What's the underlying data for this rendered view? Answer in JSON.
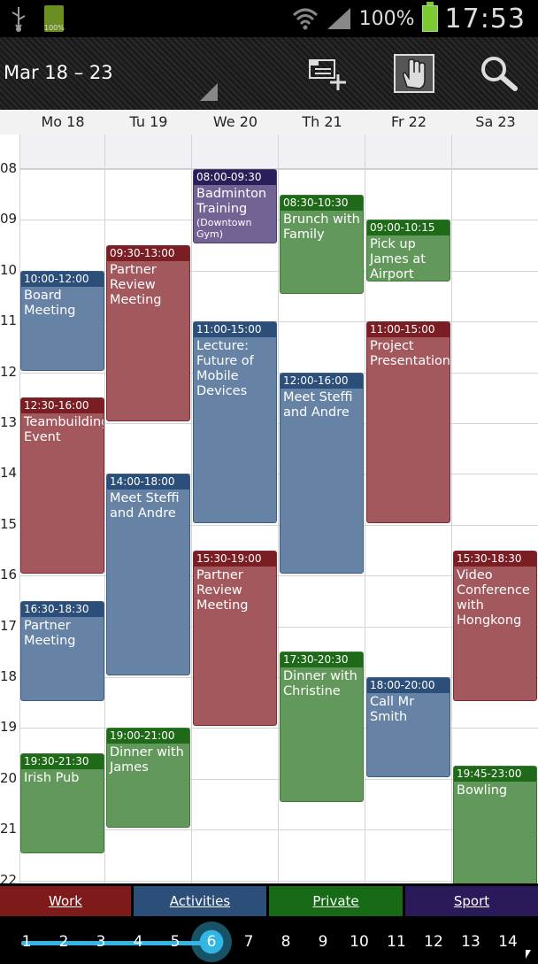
{
  "status": {
    "battery_small_label": "100%",
    "battery_pct": "100%",
    "time": "17:53"
  },
  "header": {
    "date_range": "Mar 18 – 23"
  },
  "days": [
    "Mo 18",
    "Tu 19",
    "We 20",
    "Th 21",
    "Fr 22",
    "Sa 23"
  ],
  "hours": [
    "08",
    "09",
    "10",
    "11",
    "12",
    "13",
    "14",
    "15",
    "16",
    "17",
    "18",
    "19",
    "20",
    "21",
    "22"
  ],
  "events": [
    {
      "day": 0,
      "start": 10.0,
      "end": 12.0,
      "cat": "act",
      "time": "10:00-12:00",
      "title": "Board Meeting"
    },
    {
      "day": 0,
      "start": 12.5,
      "end": 16.0,
      "cat": "work",
      "time": "12:30-16:00",
      "title": "Teambuilding Event"
    },
    {
      "day": 0,
      "start": 16.5,
      "end": 18.5,
      "cat": "act",
      "time": "16:30-18:30",
      "title": "Partner Meeting"
    },
    {
      "day": 0,
      "start": 19.5,
      "end": 21.5,
      "cat": "priv",
      "time": "19:30-21:30",
      "title": "Irish Pub"
    },
    {
      "day": 1,
      "start": 9.5,
      "end": 13.0,
      "cat": "work",
      "time": "09:30-13:00",
      "title": "Partner Review Meeting"
    },
    {
      "day": 1,
      "start": 14.0,
      "end": 18.0,
      "cat": "act",
      "time": "14:00-18:00",
      "title": "Meet Steffi and Andre"
    },
    {
      "day": 1,
      "start": 19.0,
      "end": 21.0,
      "cat": "priv",
      "time": "19:00-21:00",
      "title": "Dinner with James"
    },
    {
      "day": 2,
      "start": 8.0,
      "end": 9.5,
      "cat": "sport",
      "time": "08:00-09:30",
      "title": "Badminton Training",
      "sub": "(Downtown Gym)"
    },
    {
      "day": 2,
      "start": 11.0,
      "end": 15.0,
      "cat": "act",
      "time": "11:00-15:00",
      "title": "Lecture: Future of Mobile Devices"
    },
    {
      "day": 2,
      "start": 15.5,
      "end": 19.0,
      "cat": "work",
      "time": "15:30-19:00",
      "title": "Partner Review Meeting"
    },
    {
      "day": 3,
      "start": 8.5,
      "end": 10.5,
      "cat": "priv",
      "time": "08:30-10:30",
      "title": "Brunch with Family"
    },
    {
      "day": 3,
      "start": 12.0,
      "end": 16.0,
      "cat": "act",
      "time": "12:00-16:00",
      "title": "Meet Steffi and Andre"
    },
    {
      "day": 3,
      "start": 17.5,
      "end": 20.5,
      "cat": "priv",
      "time": "17:30-20:30",
      "title": "Dinner with Christine"
    },
    {
      "day": 4,
      "start": 9.0,
      "end": 10.25,
      "cat": "priv",
      "time": "09:00-10:15",
      "title": "Pick up James at Airport"
    },
    {
      "day": 4,
      "start": 11.0,
      "end": 15.0,
      "cat": "work",
      "time": "11:00-15:00",
      "title": "Project Presentation"
    },
    {
      "day": 4,
      "start": 18.0,
      "end": 20.0,
      "cat": "act",
      "time": "18:00-20:00",
      "title": "Call Mr Smith"
    },
    {
      "day": 5,
      "start": 15.5,
      "end": 18.5,
      "cat": "work",
      "time": "15:30-18:30",
      "title": "Video Conference with Hongkong"
    },
    {
      "day": 5,
      "start": 19.75,
      "end": 23.0,
      "cat": "priv",
      "time": "19:45-23:00",
      "title": "Bowling"
    }
  ],
  "legend": {
    "work": "Work",
    "activities": "Activities",
    "private": "Private",
    "sport": "Sport"
  },
  "day_numbers": [
    "1",
    "2",
    "3",
    "4",
    "5",
    "6",
    "7",
    "8",
    "9",
    "10",
    "11",
    "12",
    "13",
    "14"
  ],
  "selected_day": "6",
  "colors": {
    "work": "#7a1e24",
    "activities": "#2c4f7a",
    "private": "#1f6a18",
    "sport": "#2a1f5a",
    "accent": "#33b5e5"
  }
}
